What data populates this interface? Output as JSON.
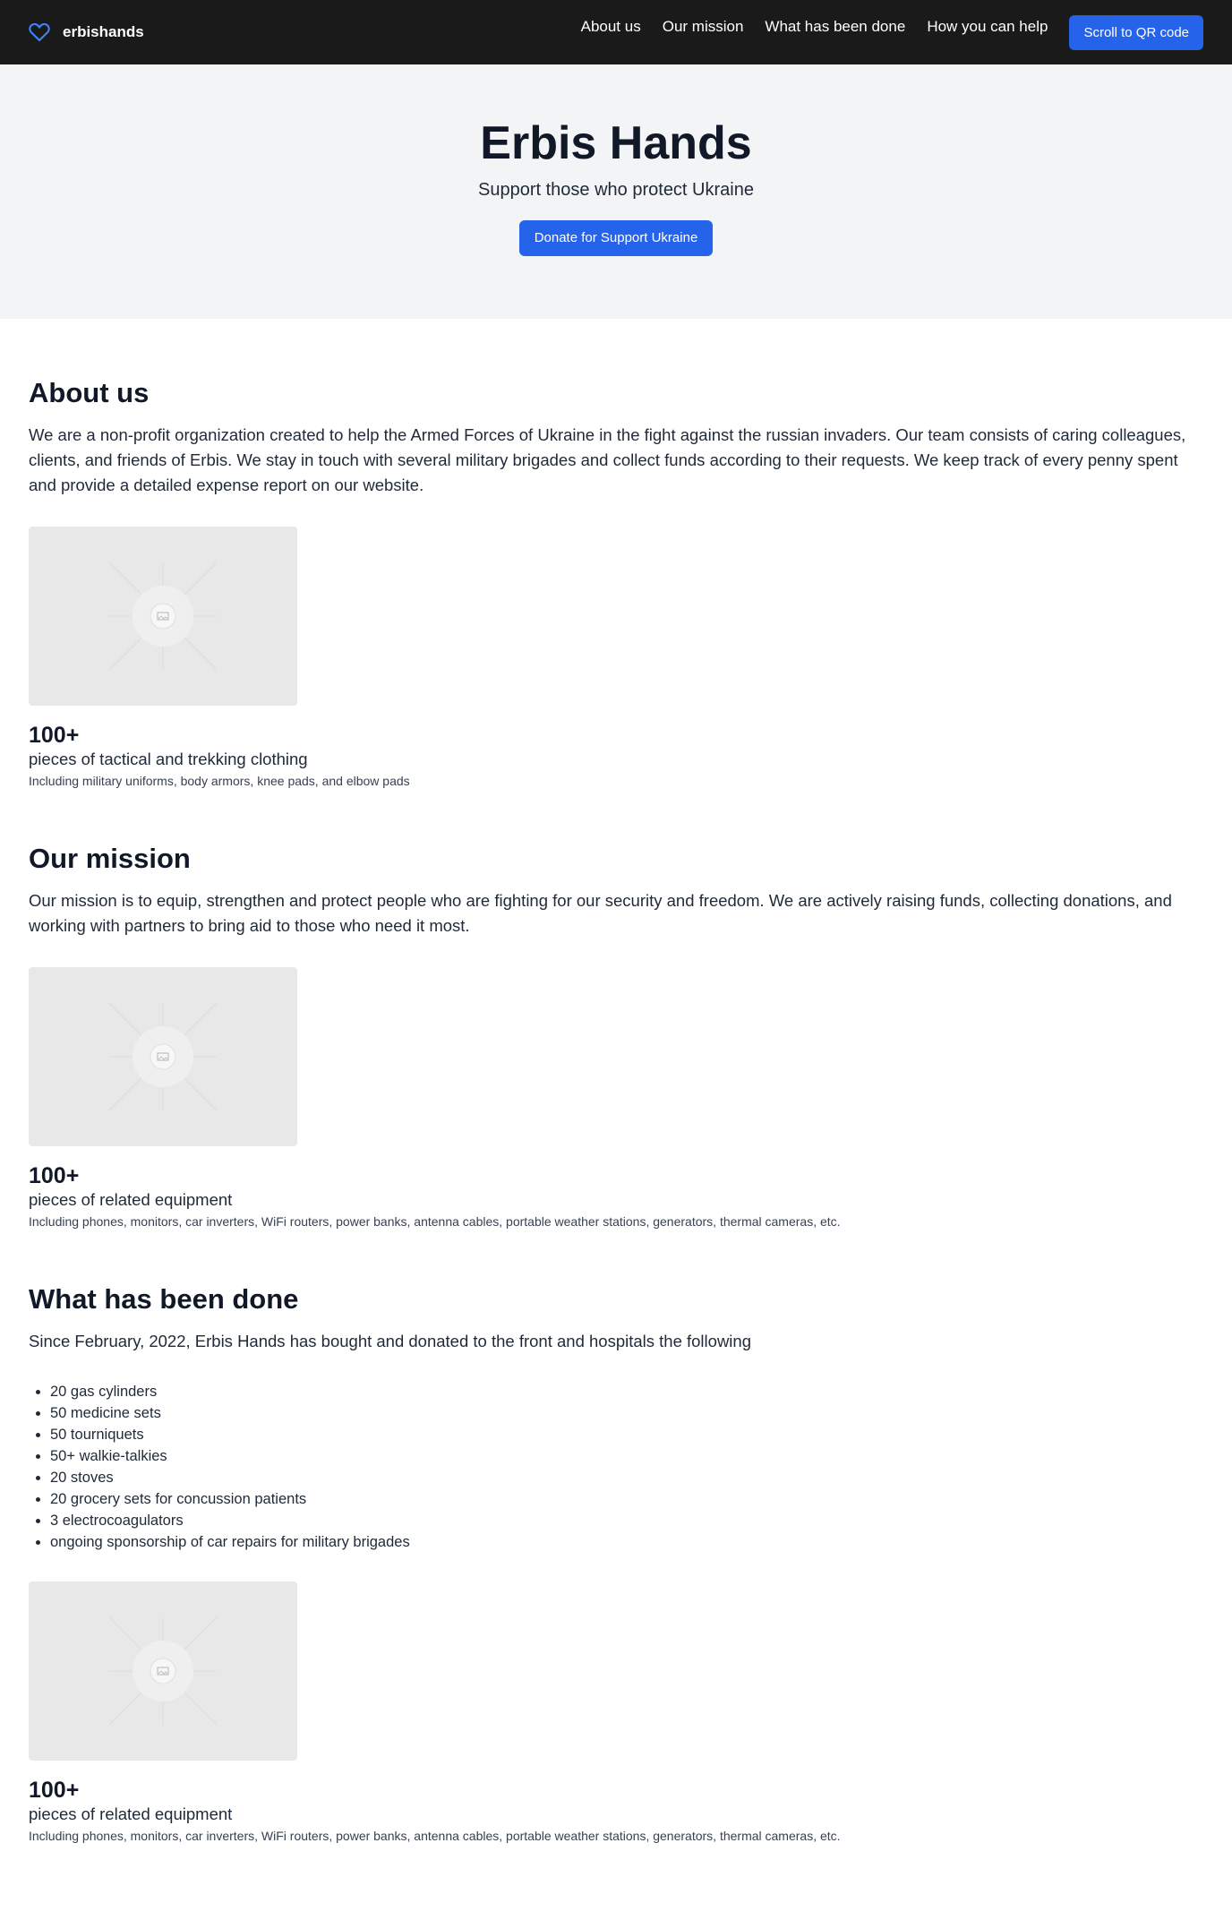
{
  "nav": {
    "brand": "erbishands",
    "links": [
      "About us",
      "Our mission",
      "What has been done",
      "How you can help"
    ],
    "cta": "Scroll to QR code"
  },
  "hero": {
    "title": "Erbis Hands",
    "subtitle": "Support those who protect Ukraine",
    "button": "Donate for Support Ukraine"
  },
  "about": {
    "title": "About us",
    "text": "We are a non-profit organization created to help the Armed Forces of Ukraine in the fight against the russian invaders. Our team consists of caring colleagues, clients, and friends of Erbis. We stay in touch with several military brigades and collect funds according to their requests. We keep track of every penny spent and provide a detailed expense report on our website.",
    "stat": {
      "value": "100+",
      "label": "pieces of tactical and trekking clothing",
      "desc": "Including military uniforms, body armors, knee pads, and elbow pads"
    }
  },
  "mission": {
    "title": "Our mission",
    "text": "Our mission is to equip, strengthen and protect people who are fighting for our security and freedom. We are actively raising funds, collecting donations, and working with partners to bring aid to those who need it most.",
    "stat": {
      "value": "100+",
      "label": "pieces of related equipment",
      "desc": "Including phones, monitors, car inverters, WiFi routers, power banks, antenna cables, portable weather stations, generators, thermal cameras, etc."
    }
  },
  "done": {
    "title": "What has been done",
    "text": "Since February, 2022, Erbis Hands has bought and donated to the front and hospitals the following",
    "items": [
      "20 gas cylinders",
      "50 medicine sets",
      "50 tourniquets",
      "50+ walkie-talkies",
      "20 stoves",
      "20 grocery sets for concussion patients",
      "3 electrocoagulators",
      "ongoing sponsorship of car repairs for military brigades"
    ],
    "stat": {
      "value": "100+",
      "label": "pieces of related equipment",
      "desc": "Including phones, monitors, car inverters, WiFi routers, power banks, antenna cables, portable weather stations, generators, thermal cameras, etc."
    }
  },
  "colors": {
    "nav_bg": "#1a1a1a",
    "accent": "#2563eb",
    "hero_bg": "#f3f4f6",
    "heading": "#111827",
    "placeholder_bg": "#e8e8e8"
  },
  "icons": {
    "brand": "heart-icon",
    "placeholder": "image-placeholder-icon"
  }
}
